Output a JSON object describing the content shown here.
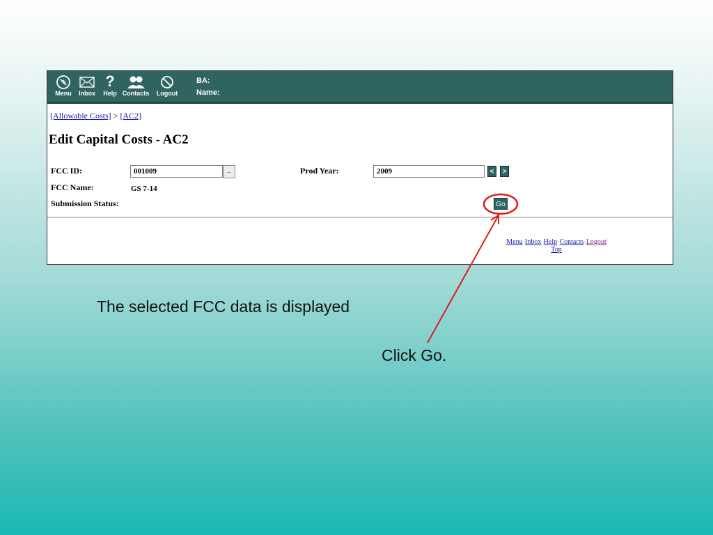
{
  "toolbar": {
    "buttons": [
      {
        "label": "Menu",
        "icon": "menu-icon"
      },
      {
        "label": "Inbox",
        "icon": "envelope-icon"
      },
      {
        "label": "Help",
        "icon": "question-icon"
      },
      {
        "label": "Contacts",
        "icon": "people-icon"
      },
      {
        "label": "Logout",
        "icon": "logout-icon"
      }
    ],
    "ba_label": "BA:",
    "name_label": "Name:"
  },
  "breadcrumb": {
    "first": "[Allowable Costs]",
    "separator": ">",
    "second": "[AC2]"
  },
  "page_title": "Edit Capital Costs - AC2",
  "form": {
    "fcc_id_label": "FCC ID:",
    "fcc_id_value": "001009",
    "lookup_label": "...",
    "prod_year_label": "Prod Year:",
    "prod_year_value": "2009",
    "prev_label": "<",
    "next_label": ">",
    "fcc_name_label": "FCC Name:",
    "fcc_name_value": "GS 7-14",
    "submission_status_label": "Submission Status:",
    "go_label": "Go"
  },
  "footer": {
    "menu": "Menu",
    "inbox": "Inbox",
    "help": "Help",
    "contacts": "Contacts",
    "logout": "Logout",
    "top": "Top"
  },
  "annotations": {
    "caption": "The selected FCC data is displayed",
    "instruction": "Click Go."
  },
  "colors": {
    "toolbar": "#2f6461",
    "callout": "#e01b1b",
    "link": "#1a1aa6"
  }
}
